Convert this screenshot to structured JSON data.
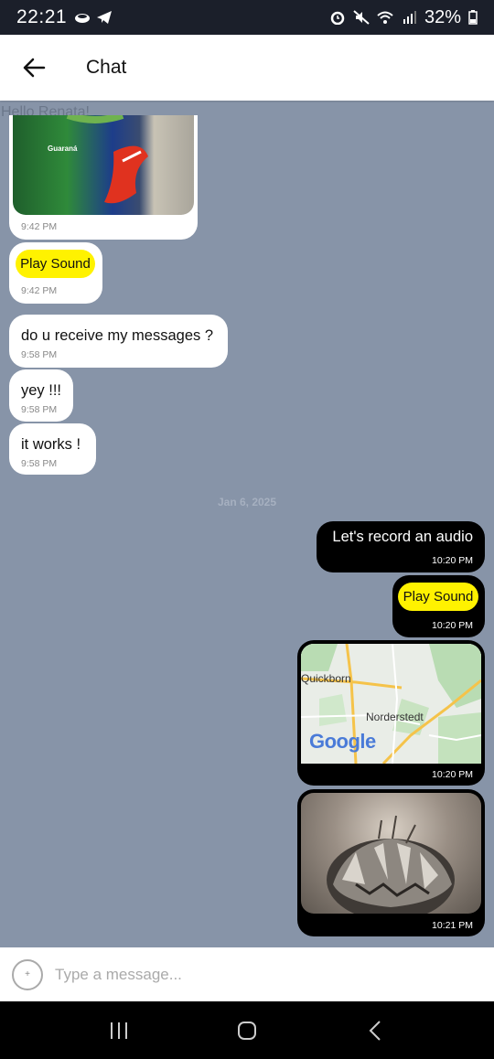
{
  "status_bar": {
    "time": "22:21",
    "battery": "32%"
  },
  "header": {
    "title": "Chat"
  },
  "chat": {
    "greeting": "Hello Renata!",
    "date_separator": "Jan 6, 2025",
    "incoming": [
      {
        "type": "image",
        "time": "9:42 PM",
        "image_text": "Guaraná"
      },
      {
        "type": "sound",
        "button": "Play Sound",
        "time": "9:42 PM"
      },
      {
        "type": "text",
        "text": "do u receive my messages ?",
        "time": "9:58 PM"
      },
      {
        "type": "text",
        "text": "yey !!!",
        "time": "9:58 PM"
      },
      {
        "type": "text",
        "text": "it works !",
        "time": "9:58 PM"
      }
    ],
    "outgoing": [
      {
        "type": "text",
        "text": "Let's record an audio",
        "time": "10:20 PM"
      },
      {
        "type": "sound",
        "button": "Play Sound",
        "time": "10:20 PM"
      },
      {
        "type": "map",
        "time": "10:20 PM",
        "labels": [
          "Quickborn",
          "Norderstedt"
        ],
        "logo": "Google"
      },
      {
        "type": "image",
        "time": "10:21 PM"
      }
    ]
  },
  "input": {
    "placeholder": "Type a message...",
    "add_symbol": "+"
  },
  "colors": {
    "chat_bg": "#8794a8",
    "incoming_bubble": "#ffffff",
    "outgoing_bubble": "#000000",
    "play_button": "#fff200"
  }
}
